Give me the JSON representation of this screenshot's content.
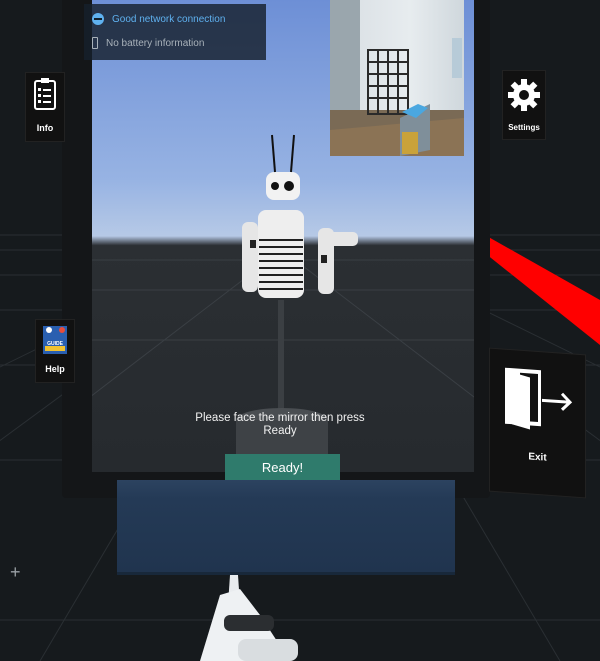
{
  "status": {
    "network": "Good network connection",
    "battery": "No battery information"
  },
  "left_menu": {
    "info": "Info",
    "help": "Help",
    "help_tile_caption": "GUIDE"
  },
  "right_menu": {
    "settings": "Settings",
    "exit": "Exit"
  },
  "instruction": "Please face the mirror then press Ready",
  "ready_button": "Ready!",
  "colors": {
    "ready_button": "#2f7b6c",
    "network_ok": "#5fb1ef",
    "laser": "#ff0000",
    "counter": "#243a56"
  }
}
